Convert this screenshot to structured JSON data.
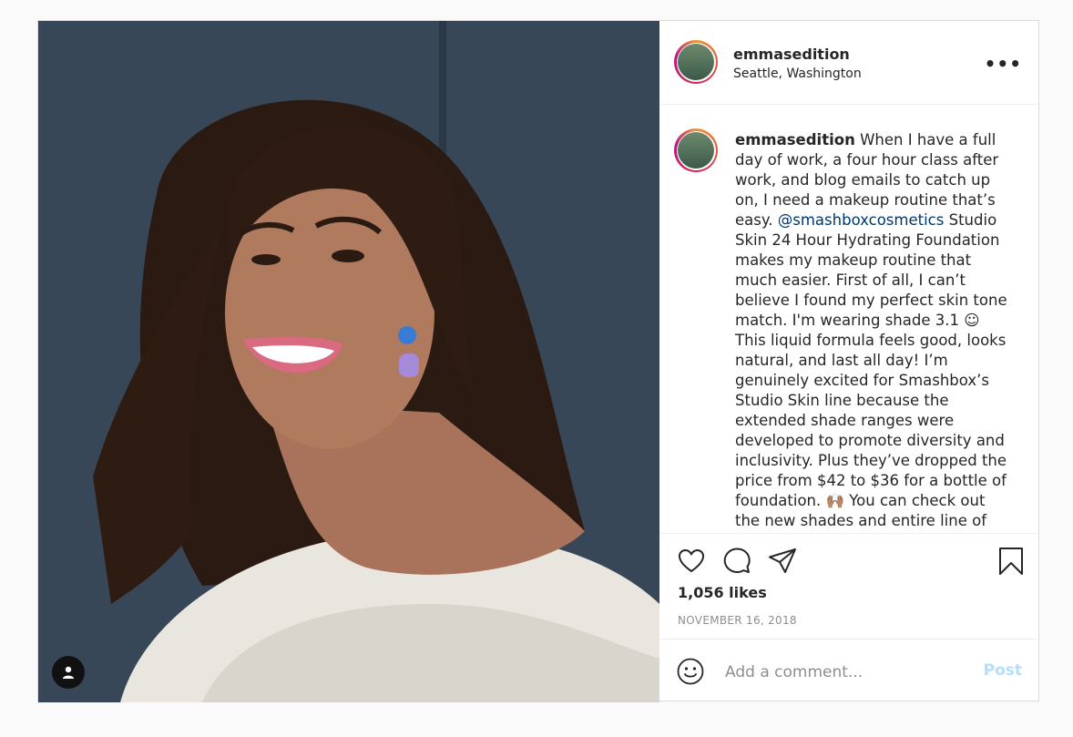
{
  "post": {
    "username": "emmasedition",
    "location": "Seattle, Washington",
    "more_label": "•••",
    "caption_user": "emmasedition",
    "caption_part1": "When I have a full day of work, a four hour class after work, and blog emails to catch up on, I need a makeup routine that’s easy. ",
    "caption_mention": "@smashboxcosmetics",
    "caption_part2": " Studio Skin 24 Hour Hydrating Foundation makes my makeup routine that much easier. First of all, I can’t believe I found my perfect skin tone match. I'm wearing shade 3.1 ☺ This liquid formula feels good, looks natural, and last all day! I’m genuinely excited for Smashbox’s Studio Skin line because the extended shade ranges were developed to promote diversity and inclusivity. Plus they’ve dropped the price from $42 to $36 for a bottle of foundation. 🙌🏽 You can check out the new shades and entire line of Studio Skin Hydrating Foundation when you click the link in",
    "likes": "1,056 likes",
    "date": "NOVEMBER 16, 2018"
  },
  "comment": {
    "placeholder": "Add a comment...",
    "post_label": "Post"
  },
  "icons": {
    "like": "heart-icon",
    "comment": "comment-icon",
    "share": "share-icon",
    "save": "bookmark-icon",
    "emoji": "emoji-icon",
    "tags": "user-tag-icon"
  },
  "colors": {
    "mention": "#00376b",
    "post_button": "#b2dffc",
    "border": "#dbdbdb"
  }
}
